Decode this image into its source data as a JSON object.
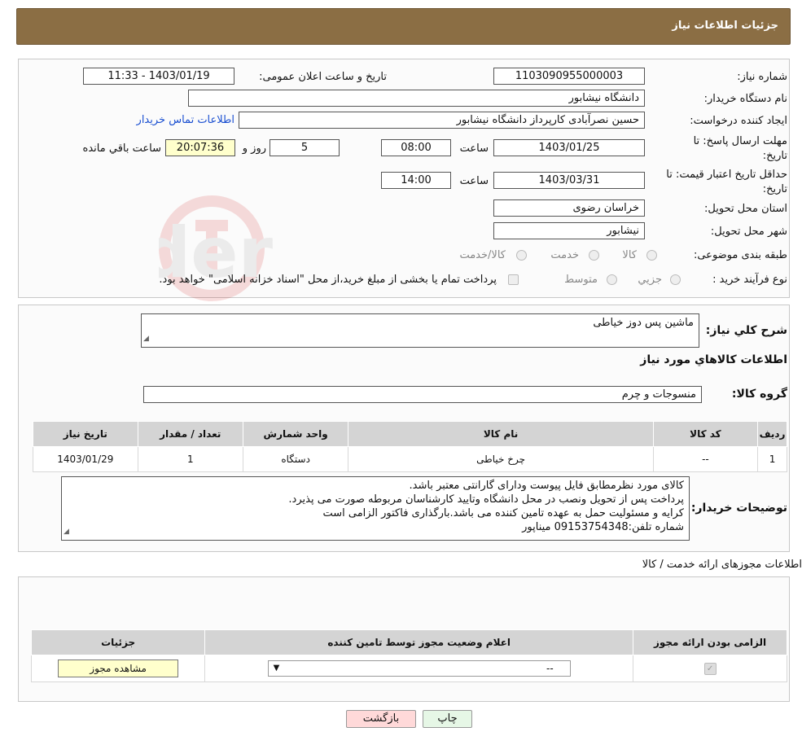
{
  "header": {
    "title": "جزئیات اطلاعات نیاز"
  },
  "fields": {
    "need_number_label": "شماره نیاز:",
    "need_number": "1103090955000003",
    "announce_label": "تاریخ و ساعت اعلان عمومی:",
    "announce_value": "1403/01/19 - 11:33",
    "buyer_org_label": "نام دستگاه خریدار:",
    "buyer_org": "دانشگاه نیشابور",
    "creator_label": "ایجاد کننده درخواست:",
    "creator": "حسین نصرآبادی کارپرداز دانشگاه نیشابور",
    "contact_link": "اطلاعات تماس خریدار",
    "deadline_label_1": "مهلت ارسال پاسخ: تا",
    "deadline_label_2": "تاریخ:",
    "deadline_date": "1403/01/25",
    "time_label": "ساعت",
    "deadline_time": "08:00",
    "days_value": "5",
    "days_label": "روز و",
    "remaining_time": "20:07:36",
    "remaining_label": "ساعت باقي مانده",
    "validity_label_1": "حداقل تاریخ اعتبار قیمت: تا",
    "validity_label_2": "تاریخ:",
    "validity_date": "1403/03/31",
    "validity_time": "14:00",
    "province_label": "استان محل تحویل:",
    "province": "خراسان رضوی",
    "city_label": "شهر محل تحویل:",
    "city": "نیشابور",
    "category_label": "طبقه بندی موضوعی:",
    "category_options": [
      "کالا",
      "خدمت",
      "کالا/خدمت"
    ],
    "purchase_type_label": "نوع فرآیند خرید :",
    "purchase_options": [
      "جزیي",
      "متوسط"
    ],
    "purchase_note": "پرداخت تمام یا بخشی از مبلغ خرید،از محل \"اسناد خزانه اسلامی\" خواهد بود."
  },
  "summary": {
    "description_label": "شرح کلي نياز:",
    "description": "ماشین پس دوز خیاطی",
    "goods_info_title": "اطلاعات کالاهاي مورد نياز",
    "group_label": "گروه کالا:",
    "group_value": "منسوجات و چرم"
  },
  "goods_table": {
    "headers": [
      "رديف",
      "کد کالا",
      "نام کالا",
      "واحد شمارش",
      "تعداد / مقدار",
      "تاریخ نیاز"
    ],
    "rows": [
      [
        "1",
        "--",
        "چرخ خیاطی",
        "دستگاه",
        "1",
        "1403/01/29"
      ]
    ]
  },
  "buyer_notes": {
    "label": "توضیحات خریدار:",
    "lines": [
      "کالای مورد نظرمطابق فایل پیوست ودارای گارانتی معتبر باشد.",
      "پرداخت پس از تحویل ونصب در محل دانشگاه وتایید کارشناسان مربوطه صورت می پذیرد.",
      "کرایه و مسئولیت حمل به عهده تامین کننده می باشد.بارگذاری فاکتور الزامی است",
      "شماره تلفن:09153754348 میناپور"
    ]
  },
  "licenses": {
    "title": "اطلاعات مجوزهای ارائه خدمت / کالا",
    "headers": [
      "الزامی بودن ارائه مجوز",
      "اعلام وضعیت مجوز توسط تامین کننده",
      "جزئیات"
    ],
    "select_value": "--",
    "view_button": "مشاهده مجوز"
  },
  "actions": {
    "print": "چاپ",
    "back": "بازگشت"
  },
  "colors": {
    "header_bg": "#8b6e44",
    "link": "#1a4fd1",
    "back_btn": "#ffd9d9",
    "print_btn": "#e6f7e6"
  }
}
